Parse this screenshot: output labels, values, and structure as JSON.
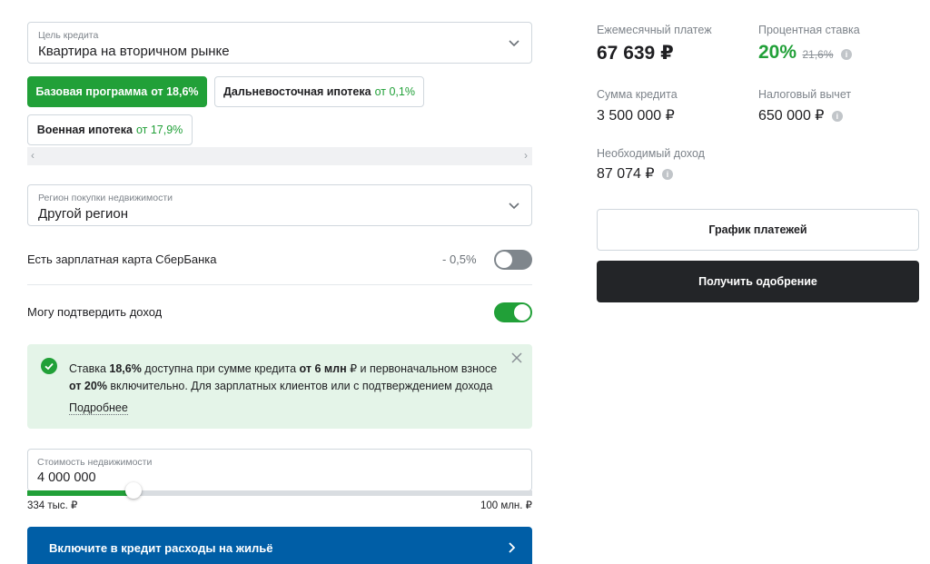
{
  "purpose": {
    "label": "Цель кредита",
    "value": "Квартира на вторичном рынке"
  },
  "programs": [
    {
      "name": "Базовая программа",
      "rate": "от 18,6%"
    },
    {
      "name": "Дальневосточная ипотека",
      "rate": "от 0,1%"
    },
    {
      "name": "Военная ипотека",
      "rate": "от 17,9%"
    }
  ],
  "region": {
    "label": "Регион покупки недвижимости",
    "value": "Другой регион"
  },
  "salary_card": {
    "label": "Есть зарплатная карта СберБанка",
    "discount": "- 0,5%",
    "enabled": false
  },
  "income_confirm": {
    "label": "Могу подтвердить доход",
    "enabled": true
  },
  "notice": {
    "t1": "Ставка ",
    "b1": "18,6%",
    "t2": " доступна при сумме кредита ",
    "b2": "от 6 млн",
    "t3": " ₽ и первоначальном взносе ",
    "b3": "от 20%",
    "t4": " включительно. Для зарплатных клиентов или с подтверждением дохода",
    "more": "Подробнее"
  },
  "property_cost": {
    "label": "Стоимость недвижимости",
    "value": "4 000 000",
    "min": "334 тыс. ₽",
    "max": "100 млн. ₽",
    "slider_fraction": 0.21
  },
  "expenses_button": "Включите в кредит расходы на жильё",
  "summary": {
    "monthly_label": "Ежемесячный платеж",
    "monthly_value": "67 639 ₽",
    "rate_label": "Процентная ставка",
    "rate_value": "20%",
    "rate_old": "21,6%",
    "loan_label": "Сумма кредита",
    "loan_value": "3 500 000 ₽",
    "tax_label": "Налоговый вычет",
    "tax_value": "650 000 ₽",
    "income_label": "Необходимый доход",
    "income_value": "87 074 ₽"
  },
  "schedule_button": "График платежей",
  "approval_button": "Получить одобрение",
  "colors": {
    "accent": "#21a038",
    "blue": "#005ea6",
    "dark": "#232528"
  }
}
